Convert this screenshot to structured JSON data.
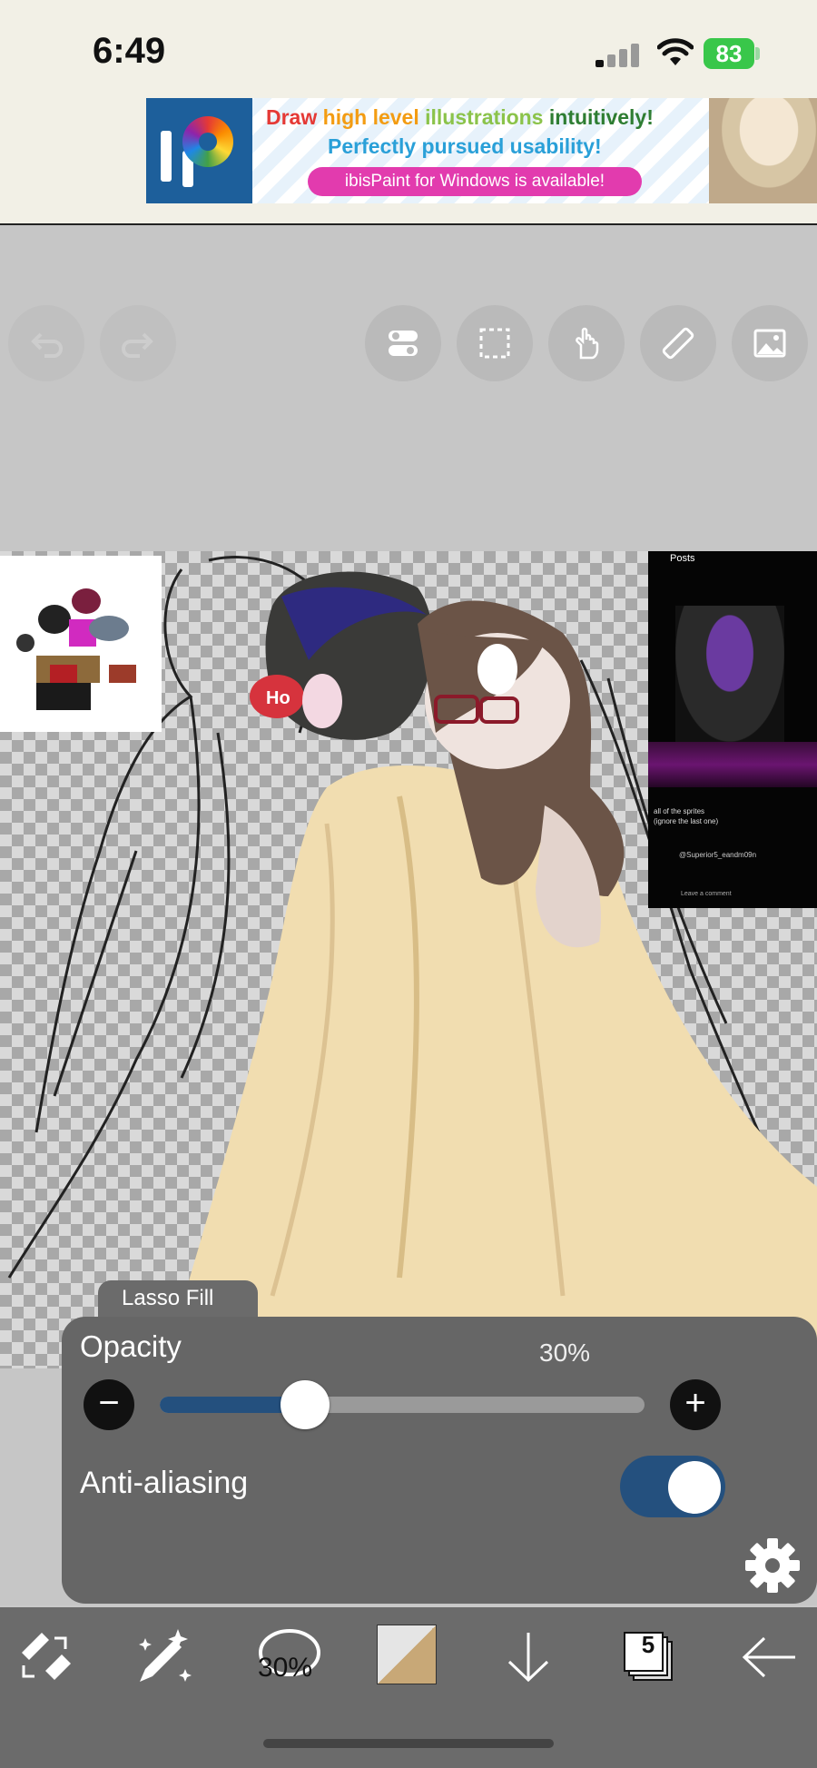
{
  "status_bar": {
    "time": "6:49",
    "battery": "83"
  },
  "ad": {
    "line1_parts": [
      "Draw",
      "high level",
      "illustrations",
      "intuitively!"
    ],
    "line1_colors": [
      "#e53935",
      "#f39c12",
      "#8bc34a",
      "#2e7d32"
    ],
    "line2": "Perfectly pursued usability!",
    "pill": "ibisPaint for Windows is available!"
  },
  "top_tools": {
    "undo": "undo-icon",
    "redo": "redo-icon",
    "items": [
      "toggle-icon",
      "selection-icon",
      "hand-icon",
      "ruler-icon",
      "image-icon"
    ]
  },
  "reference_right": {
    "header": "Posts",
    "caption1": "all of the sprites",
    "caption2": "(ignore the last one)",
    "user": "@Superior5_eandm09n",
    "comment": "Leave a comment"
  },
  "tool_panel": {
    "tool_name": "Lasso Fill",
    "opacity_label": "Opacity",
    "opacity_value": "30%",
    "opacity_fraction": 0.3,
    "minus": "−",
    "plus": "+",
    "anti_aliasing_label": "Anti-aliasing",
    "anti_aliasing_on": true
  },
  "bottom_toolbar": {
    "brush_size": "30%",
    "primary_color": "#c8a877",
    "layers_count": "5"
  },
  "colors": {
    "slider_fill": "#24507e",
    "panel_bg": "#666666",
    "toolbar_bg": "#6b6b6b"
  }
}
